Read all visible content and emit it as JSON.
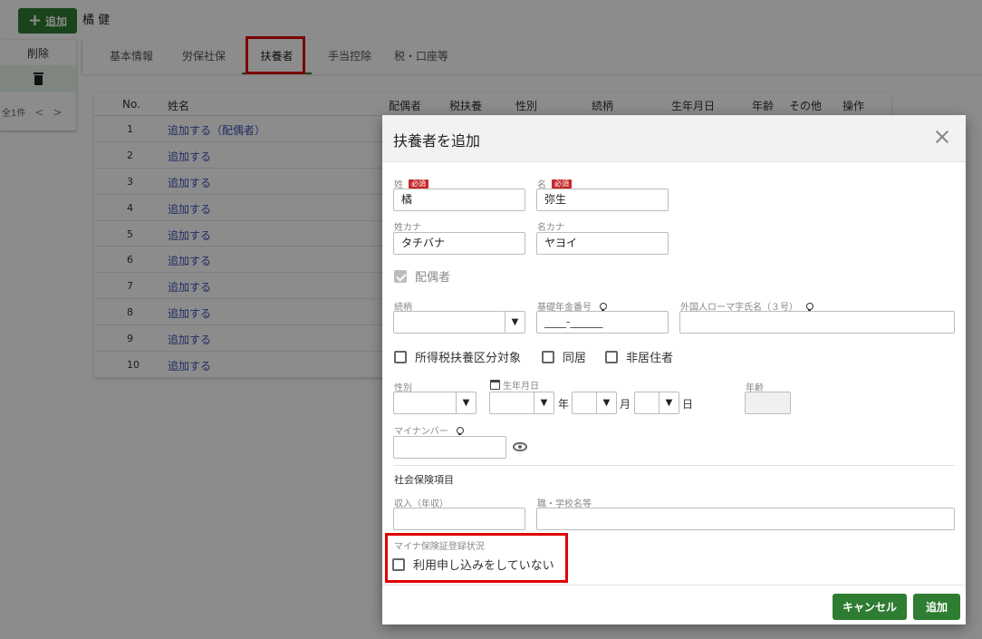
{
  "header": {
    "add_label": "追加",
    "employee_name": "橘 健"
  },
  "left_panel": {
    "delete_label": "削除",
    "count": "全1件",
    "prev": "<",
    "next": ">"
  },
  "tabs": [
    {
      "label": "基本情報"
    },
    {
      "label": "労保社保"
    },
    {
      "label": "扶養者"
    },
    {
      "label": "手当控除"
    },
    {
      "label": "税・口座等"
    }
  ],
  "table": {
    "columns": [
      "No.",
      "姓名",
      "配偶者",
      "税扶養",
      "性別",
      "続柄",
      "生年月日",
      "年齢",
      "その他",
      "操作"
    ],
    "rows": [
      {
        "no": "1",
        "name": "追加する（配偶者）"
      },
      {
        "no": "2",
        "name": "追加する"
      },
      {
        "no": "3",
        "name": "追加する"
      },
      {
        "no": "4",
        "name": "追加する"
      },
      {
        "no": "5",
        "name": "追加する"
      },
      {
        "no": "6",
        "name": "追加する"
      },
      {
        "no": "7",
        "name": "追加する"
      },
      {
        "no": "8",
        "name": "追加する"
      },
      {
        "no": "9",
        "name": "追加する"
      },
      {
        "no": "10",
        "name": "追加する"
      }
    ]
  },
  "modal": {
    "title": "扶養者を追加",
    "required_badge": "必須",
    "last_name": {
      "label": "姓",
      "value": "橘"
    },
    "first_name": {
      "label": "名",
      "value": "弥生"
    },
    "last_kana": {
      "label": "姓カナ",
      "value": "タチバナ"
    },
    "first_kana": {
      "label": "名カナ",
      "value": "ヤヨイ"
    },
    "spouse": {
      "label": "配偶者",
      "checked": true
    },
    "relation": {
      "label": "続柄"
    },
    "pension": {
      "label": "基礎年金番号",
      "value": "____-______"
    },
    "roman_name": {
      "label": "外国人ローマ字氏名（３号）"
    },
    "tax_dependent": {
      "label": "所得税扶養区分対象"
    },
    "cohabit": {
      "label": "同居"
    },
    "nonresident": {
      "label": "非居住者"
    },
    "gender": {
      "label": "性別"
    },
    "birth": {
      "label": "生年月日",
      "year_unit": "年",
      "month_unit": "月",
      "day_unit": "日"
    },
    "age": {
      "label": "年齢"
    },
    "mynumber": {
      "label": "マイナンバー"
    },
    "social_section": "社会保険項目",
    "income": {
      "label": "収入（年収）"
    },
    "job": {
      "label": "職・学校名等"
    },
    "myna_status": {
      "label": "マイナ保険証登録状況",
      "option": "利用申し込みをしていない"
    },
    "cancel_label": "キャンセル",
    "add_label": "追加"
  }
}
